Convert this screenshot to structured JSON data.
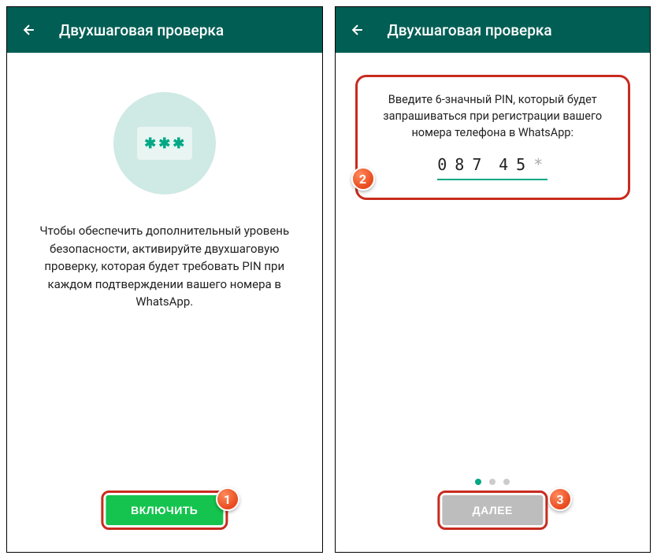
{
  "screen1": {
    "header": {
      "title": "Двухшаговая проверка"
    },
    "description": "Чтобы обеспечить дополнительный уровень безопасности, активируйте двухшаговую проверку, которая будет требовать PIN при каждом подтверждении вашего номера в WhatsApp.",
    "button_label": "ВКЛЮЧИТЬ",
    "callout": "1"
  },
  "screen2": {
    "header": {
      "title": "Двухшаговая проверка"
    },
    "pin_prompt": "Введите 6-значный PIN, который будет запрашиваться при регистрации вашего номера телефона в WhatsApp:",
    "pin_digits": [
      "0",
      "8",
      "7",
      "4",
      "5",
      "*"
    ],
    "button_label": "ДАЛЕЕ",
    "callout_section": "2",
    "callout_button": "3"
  }
}
